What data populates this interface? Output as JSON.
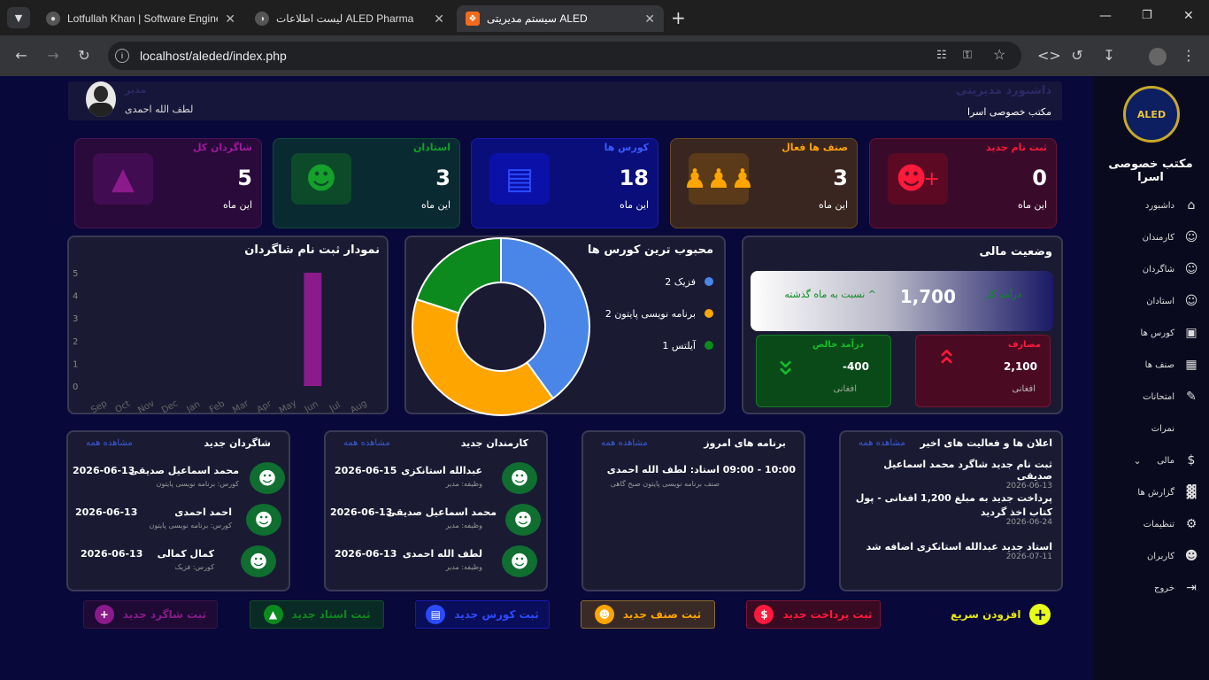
{
  "browser": {
    "tabs": [
      {
        "title": "Lotfullah Khan | Software Engine",
        "icon": "user-avatar-icon"
      },
      {
        "title": "لیست اطلاعات ALED Pharma",
        "icon": "globe-icon"
      },
      {
        "title": "سیستم مدیریتی ALED",
        "icon": "xampp-icon"
      }
    ],
    "url": "localhost/aleded/index.php"
  },
  "sidebar": {
    "logo_text": "ALED",
    "brand": "مکتب خصوصی اسرا",
    "items": [
      {
        "label": "داشبورد",
        "icon": "home-icon"
      },
      {
        "label": "کارمندان",
        "icon": "user-icon"
      },
      {
        "label": "شاگردان",
        "icon": "user-icon"
      },
      {
        "label": "استادان",
        "icon": "user-icon"
      },
      {
        "label": "کورس ها",
        "icon": "book-icon"
      },
      {
        "label": "صنف ها",
        "icon": "classroom-icon"
      },
      {
        "label": "امتحانات",
        "icon": "edit-icon"
      },
      {
        "label": "نمرات",
        "icon": "none"
      },
      {
        "label": "مالی",
        "icon": "dollar-icon"
      },
      {
        "label": "گزارش ها",
        "icon": "chart-icon"
      },
      {
        "label": "تنظیمات",
        "icon": "gear-icon"
      },
      {
        "label": "کاربران",
        "icon": "users-icon"
      },
      {
        "label": "خروج",
        "icon": "logout-icon"
      }
    ]
  },
  "header": {
    "title": "داشبورد مدیریتی",
    "subtitle": "مکتب خصوصی اسرا",
    "user_role": "مدیر",
    "user_name": "لطف الله احمدی"
  },
  "stats": [
    {
      "title": "ثبت نام جدید",
      "value": "0",
      "sub": "این ماه",
      "color": "#ff1a3c",
      "icon": "user-plus-icon"
    },
    {
      "title": "صنف ها فعال",
      "value": "3",
      "sub": "این ماه",
      "color": "#ffa500",
      "icon": "users-icon"
    },
    {
      "title": "کورس ها",
      "value": "18",
      "sub": "این ماه",
      "color": "#2b4bff",
      "icon": "book-open-icon"
    },
    {
      "title": "استادان",
      "value": "3",
      "sub": "این ماه",
      "color": "#118a1e",
      "icon": "teacher-icon"
    },
    {
      "title": "شاگردان کل",
      "value": "5",
      "sub": "این ماه",
      "color": "#8b1a8b",
      "icon": "graduate-icon"
    }
  ],
  "finance": {
    "title": "وضعیت مالی",
    "total_label": "درآمد کل",
    "total_value": "1,700",
    "total_note": "^ نسبت به ماه گذشته",
    "expense_label": "مصارف",
    "expense_value": "2,100",
    "expense_unit": "افغانی",
    "net_label": "درآمد خالص",
    "net_value": "-400",
    "net_unit": "افغانی"
  },
  "popular_chart": {
    "title": "محبوب ترین کورس ها"
  },
  "enroll_chart": {
    "title": "نمودار ثبت نام شاگردان"
  },
  "chart_data": [
    {
      "type": "pie",
      "title": "محبوب ترین کورس ها",
      "labels": [
        "فزیک",
        "برنامه نویسی پایتون",
        "آیلتس"
      ],
      "values": [
        2,
        2,
        1
      ],
      "colors": [
        "#4a86e8",
        "#ffa500",
        "#0c8a1e"
      ],
      "legend_texts": [
        "فزیک 2",
        "برنامه نویسی پایتون 2",
        "آیلتس 1"
      ]
    },
    {
      "type": "bar",
      "title": "نمودار ثبت نام شاگردان",
      "categories": [
        "Sep",
        "Oct",
        "Nov",
        "Dec",
        "Jan",
        "Feb",
        "Mar",
        "Apr",
        "May",
        "Jun",
        "Jul",
        "Aug"
      ],
      "values": [
        0,
        0,
        0,
        0,
        0,
        0,
        0,
        0,
        0,
        5,
        0,
        0
      ],
      "yticks": [
        "0",
        "1",
        "2",
        "3",
        "4",
        "5"
      ],
      "ylim": [
        0,
        5
      ],
      "color": "#8b1a8b"
    }
  ],
  "announcements": {
    "title": "اعلان ها و فعالیت های اخیر",
    "view_all": "مشاهده همه",
    "items": [
      {
        "text": "ثبت نام جدید شاگرد محمد اسماعیل صدیقی",
        "date": "2026-06-13"
      },
      {
        "text": "پرداخت جدید به مبلغ 1,200 افغانی - پول",
        "text2": "کتاب اخذ گردید",
        "date": "2026-06-24"
      },
      {
        "text": "استاد جدید عبدالله استانکزی اضافه شد",
        "date": "2026-07-11"
      }
    ]
  },
  "today": {
    "title": "برنامه های امروز",
    "view_all": "مشاهده همه",
    "items": [
      {
        "time": "09:00 - 10:00",
        "teacher": "استاد: لطف الله احمدی",
        "detail": "صنف برنامه نویسی پایتون صبح گاهی"
      }
    ]
  },
  "employees": {
    "title": "کارمندان جدید",
    "view_all": "مشاهده همه",
    "items": [
      {
        "name": "عبدالله استانکزی",
        "role": "وظیفه: مدیر",
        "date": "2026-06-15"
      },
      {
        "name": "محمد اسماعیل صدیقی",
        "role": "وظیفه: مدیر",
        "date": "2026-06-13"
      },
      {
        "name": "لطف الله احمدی",
        "role": "وظیفه: مدیر",
        "date": "2026-06-13"
      }
    ]
  },
  "students": {
    "title": "شاگردان جدید",
    "view_all": "مشاهده همه",
    "items": [
      {
        "name": "محمد اسماعیل صدیقی",
        "course": "کورس: برنامه نویسی پایتون",
        "date": "2026-06-13"
      },
      {
        "name": "احمد احمدی",
        "course": "کورس: برنامه نویسی پایتون",
        "date": "2026-06-13"
      },
      {
        "name": "کمال کمالی",
        "course": "کورس: فزیک",
        "date": "2026-06-13"
      }
    ]
  },
  "quick": {
    "title": "افزودن سریع",
    "buttons": [
      {
        "label": "ثبت پرداخت جدید",
        "color": "#ff1a3c",
        "icon": "dollar-icon"
      },
      {
        "label": "ثبت صنف جدید",
        "color": "#ffa500",
        "icon": "users-icon"
      },
      {
        "label": "ثبت کورس جدید",
        "color": "#2b4bff",
        "icon": "book-icon"
      },
      {
        "label": "ثبت استاد جدید",
        "color": "#118a1e",
        "icon": "graduate-cap-icon"
      },
      {
        "label": "ثبت شاگرد جدید",
        "color": "#8b1a8b",
        "icon": "user-plus-icon"
      }
    ]
  }
}
